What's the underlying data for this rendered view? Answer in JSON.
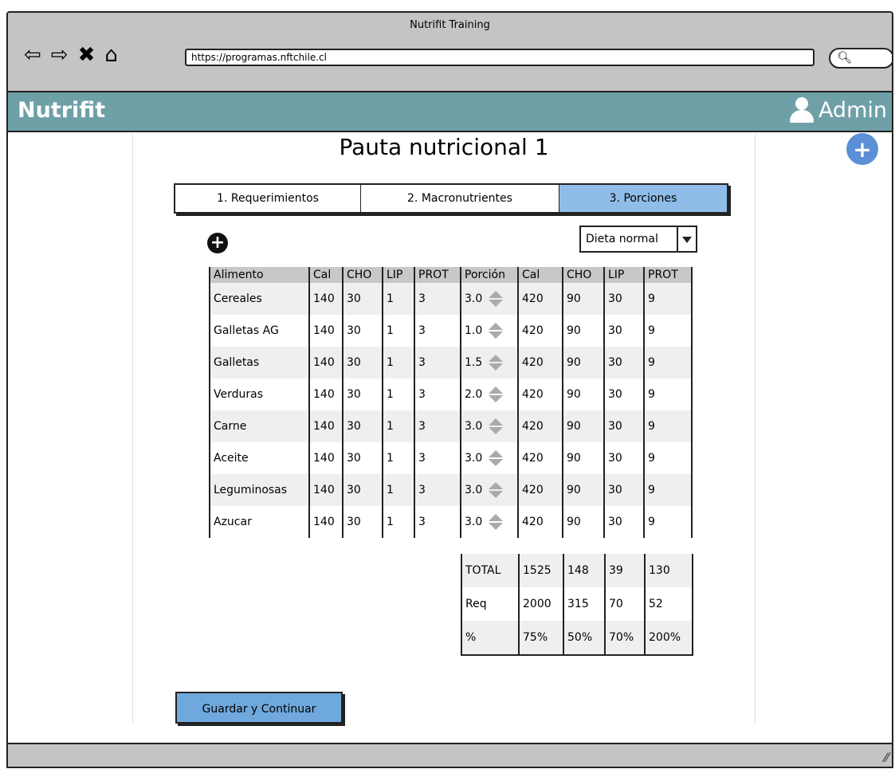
{
  "browser": {
    "window_title": "Nutrifit Training",
    "url": "https://programas.nftchile.cl",
    "back_icon": "back-arrow-icon",
    "forward_icon": "forward-arrow-icon",
    "stop_icon": "close-icon",
    "home_icon": "home-icon",
    "search_icon": "search-icon"
  },
  "app": {
    "brand": "Nutrifit",
    "user": "Admin",
    "header_color": "#6fa0a8"
  },
  "page": {
    "title": "Pauta nutricional 1"
  },
  "tabs": [
    {
      "label": "1. Requerimientos",
      "active": false
    },
    {
      "label": "2. Macronutrientes",
      "active": false
    },
    {
      "label": "3. Porciones",
      "active": true
    }
  ],
  "diet_select": {
    "value": "Dieta normal"
  },
  "table": {
    "headers": [
      "Alimento",
      "Cal",
      "CHO",
      "LIP",
      "PROT",
      "Porción",
      "Cal",
      "CHO",
      "LIP",
      "PROT"
    ],
    "rows": [
      {
        "alimento": "Cereales",
        "cal": "140",
        "cho": "30",
        "lip": "1",
        "prot": "3",
        "porcion": "3.0",
        "cal2": "420",
        "cho2": "90",
        "lip2": "30",
        "prot2": "9"
      },
      {
        "alimento": "Galletas AG",
        "cal": "140",
        "cho": "30",
        "lip": "1",
        "prot": "3",
        "porcion": "1.0",
        "cal2": "420",
        "cho2": "90",
        "lip2": "30",
        "prot2": "9"
      },
      {
        "alimento": "Galletas",
        "cal": "140",
        "cho": "30",
        "lip": "1",
        "prot": "3",
        "porcion": "1.5",
        "cal2": "420",
        "cho2": "90",
        "lip2": "30",
        "prot2": "9"
      },
      {
        "alimento": "Verduras",
        "cal": "140",
        "cho": "30",
        "lip": "1",
        "prot": "3",
        "porcion": "2.0",
        "cal2": "420",
        "cho2": "90",
        "lip2": "30",
        "prot2": "9"
      },
      {
        "alimento": "Carne",
        "cal": "140",
        "cho": "30",
        "lip": "1",
        "prot": "3",
        "porcion": "3.0",
        "cal2": "420",
        "cho2": "90",
        "lip2": "30",
        "prot2": "9"
      },
      {
        "alimento": "Aceite",
        "cal": "140",
        "cho": "30",
        "lip": "1",
        "prot": "3",
        "porcion": "3.0",
        "cal2": "420",
        "cho2": "90",
        "lip2": "30",
        "prot2": "9"
      },
      {
        "alimento": "Leguminosas",
        "cal": "140",
        "cho": "30",
        "lip": "1",
        "prot": "3",
        "porcion": "3.0",
        "cal2": "420",
        "cho2": "90",
        "lip2": "30",
        "prot2": "9"
      },
      {
        "alimento": "Azucar",
        "cal": "140",
        "cho": "30",
        "lip": "1",
        "prot": "3",
        "porcion": "3.0",
        "cal2": "420",
        "cho2": "90",
        "lip2": "30",
        "prot2": "9"
      }
    ]
  },
  "totals": [
    {
      "label": "TOTAL",
      "cal": "1525",
      "cho": "148",
      "lip": "39",
      "prot": "130"
    },
    {
      "label": "Req",
      "cal": "2000",
      "cho": "315",
      "lip": "70",
      "prot": "52"
    },
    {
      "label": "%",
      "cal": "75%",
      "cho": "50%",
      "lip": "70%",
      "prot": "200%"
    }
  ],
  "save_button": "Guardar y Continuar"
}
